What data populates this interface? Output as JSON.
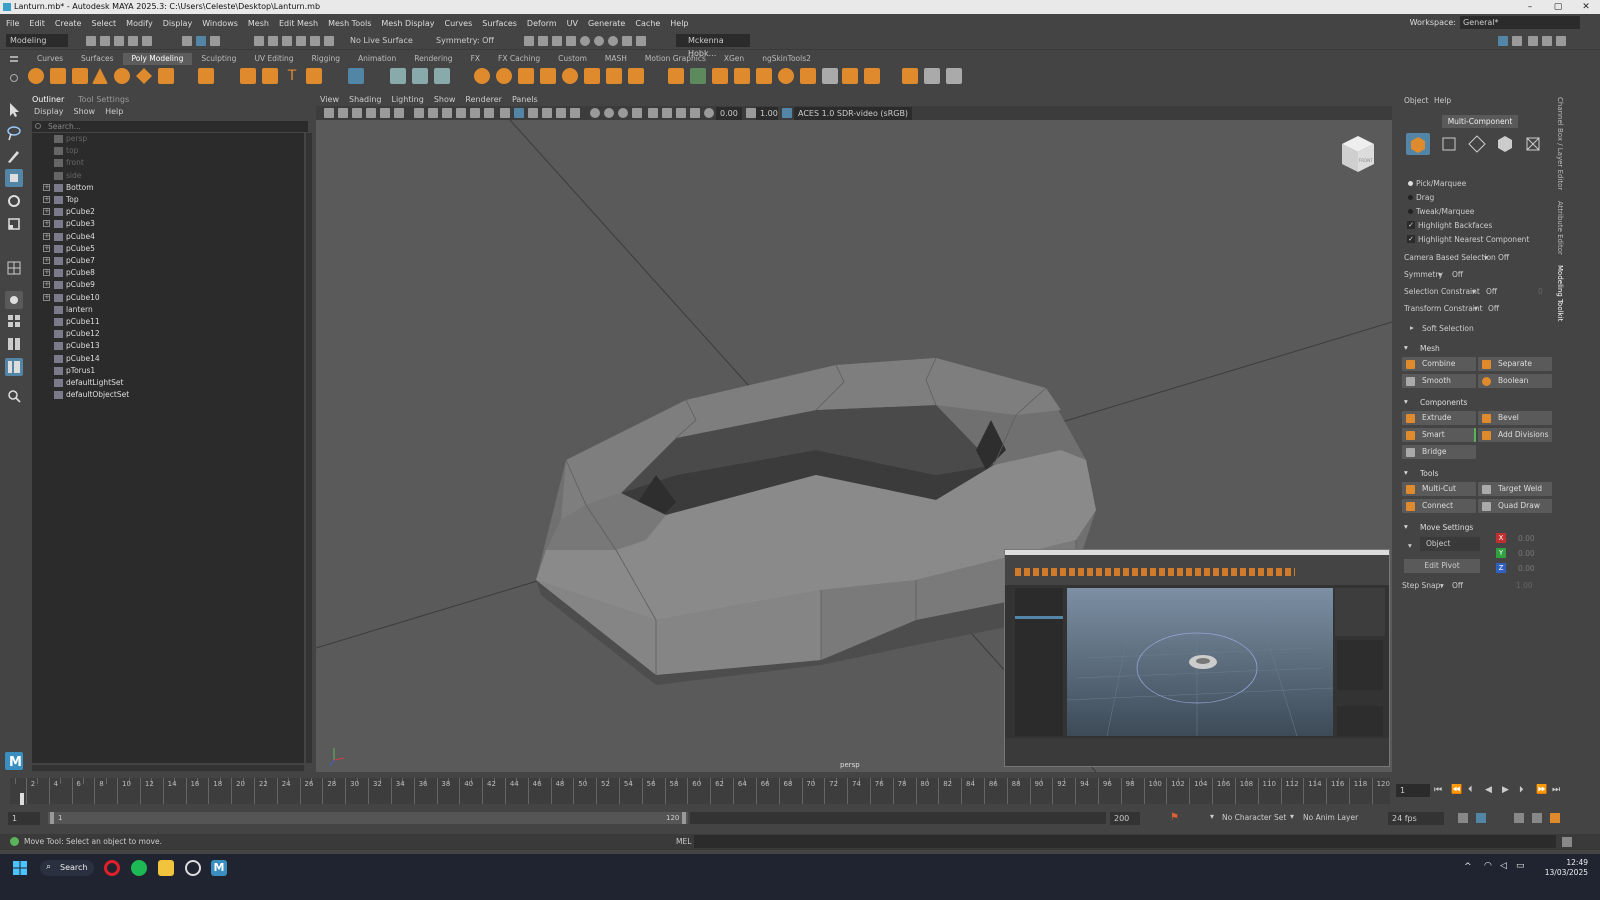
{
  "window": {
    "title": "Lanturn.mb* - Autodesk MAYA 2025.3: C:\\Users\\Celeste\\Desktop\\Lanturn.mb"
  },
  "menubar": {
    "items": [
      "File",
      "Edit",
      "Create",
      "Select",
      "Modify",
      "Display",
      "Windows",
      "Mesh",
      "Edit Mesh",
      "Mesh Tools",
      "Mesh Display",
      "Curves",
      "Surfaces",
      "Deform",
      "UV",
      "Generate",
      "Cache",
      "Help"
    ],
    "workspace_label": "Workspace:",
    "workspace_value": "General*"
  },
  "statusline": {
    "mode": "Modeling",
    "live_surface": "No Live Surface",
    "symmetry": "Symmetry: Off",
    "user": "Mckenna Hobk..."
  },
  "shelf": {
    "tabs": [
      "Curves",
      "Surfaces",
      "Poly Modeling",
      "Sculpting",
      "UV Editing",
      "Rigging",
      "Animation",
      "Rendering",
      "FX",
      "FX Caching",
      "Custom",
      "MASH",
      "Motion Graphics",
      "XGen",
      "ngSkinTools2"
    ],
    "active": "Poly Modeling"
  },
  "outliner": {
    "tabs": [
      "Outliner",
      "Tool Settings"
    ],
    "menu": [
      "Display",
      "Show",
      "Help"
    ],
    "search_placeholder": "Search...",
    "items": [
      {
        "label": "persp",
        "hidden": true,
        "expand": false
      },
      {
        "label": "top",
        "hidden": true,
        "expand": false
      },
      {
        "label": "front",
        "hidden": true,
        "expand": false
      },
      {
        "label": "side",
        "hidden": true,
        "expand": false
      },
      {
        "label": "Bottom",
        "hidden": false,
        "expand": true
      },
      {
        "label": "Top",
        "hidden": false,
        "expand": true
      },
      {
        "label": "pCube2",
        "hidden": false,
        "expand": true
      },
      {
        "label": "pCube3",
        "hidden": false,
        "expand": true
      },
      {
        "label": "pCube4",
        "hidden": false,
        "expand": true
      },
      {
        "label": "pCube5",
        "hidden": false,
        "expand": true
      },
      {
        "label": "pCube7",
        "hidden": false,
        "expand": true
      },
      {
        "label": "pCube8",
        "hidden": false,
        "expand": true
      },
      {
        "label": "pCube9",
        "hidden": false,
        "expand": true
      },
      {
        "label": "pCube10",
        "hidden": false,
        "expand": true
      },
      {
        "label": "lantern",
        "hidden": false,
        "expand": false
      },
      {
        "label": "pCube11",
        "hidden": false,
        "expand": false
      },
      {
        "label": "pCube12",
        "hidden": false,
        "expand": false
      },
      {
        "label": "pCube13",
        "hidden": false,
        "expand": false
      },
      {
        "label": "pCube14",
        "hidden": false,
        "expand": false
      },
      {
        "label": "pTorus1",
        "hidden": false,
        "expand": false
      },
      {
        "label": "defaultLightSet",
        "hidden": false,
        "expand": false
      },
      {
        "label": "defaultObjectSet",
        "hidden": false,
        "expand": false
      }
    ]
  },
  "viewport": {
    "menu": [
      "View",
      "Shading",
      "Lighting",
      "Show",
      "Renderer",
      "Panels"
    ],
    "field1": "0.00",
    "field2": "1.00",
    "colorspace": "ACES 1.0 SDR-video (sRGB)",
    "camera_label": "persp",
    "viewcube_label": "FRONT"
  },
  "modeling_toolkit": {
    "menu": [
      "Object",
      "Help"
    ],
    "mode_button": "Multi-Component",
    "pick_options": [
      "Pick/Marquee",
      "Drag",
      "Tweak/Marquee"
    ],
    "checks": [
      "Highlight Backfaces",
      "Highlight Nearest Component"
    ],
    "settings": [
      {
        "label": "Camera Based Selection",
        "value": "Off"
      },
      {
        "label": "Symmetry",
        "value": "Off"
      },
      {
        "label": "Selection Constraint",
        "value": "Off",
        "extra": "0"
      },
      {
        "label": "Transform Constraint",
        "value": "Off"
      }
    ],
    "soft_selection": "Soft Selection",
    "mesh": {
      "title": "Mesh",
      "buttons": [
        "Combine",
        "Separate",
        "Smooth",
        "Boolean"
      ]
    },
    "components": {
      "title": "Components",
      "buttons": [
        "Extrude",
        "Bevel",
        "Smart Extrude",
        "Add Divisions",
        "Bridge"
      ]
    },
    "tools": {
      "title": "Tools",
      "buttons": [
        "Multi-Cut",
        "Target Weld",
        "Connect",
        "Quad Draw"
      ]
    },
    "move_settings": {
      "title": "Move Settings",
      "space": "Object",
      "edit_pivot": "Edit Pivot",
      "step_snap_label": "Step Snap:",
      "step_snap_value": "Off",
      "step_value": "1.00",
      "x": "0.00",
      "y": "0.00",
      "z": "0.00",
      "axes": [
        "X",
        "Y",
        "Z"
      ]
    }
  },
  "side_tabs": [
    "Channel Box / Layer Editor",
    "Attribute Editor",
    "Modeling Toolkit"
  ],
  "timeline": {
    "ticks": [
      "2",
      "4",
      "6",
      "8",
      "10",
      "12",
      "14",
      "16",
      "18",
      "20",
      "22",
      "24",
      "26",
      "28",
      "30",
      "32",
      "34",
      "36",
      "38",
      "40",
      "42",
      "44",
      "46",
      "48",
      "50",
      "52",
      "54",
      "56",
      "58",
      "60",
      "62",
      "64",
      "66",
      "68",
      "70",
      "72",
      "74",
      "76",
      "78",
      "80",
      "82",
      "84",
      "86",
      "88",
      "90",
      "92",
      "94",
      "96",
      "98",
      "100",
      "102",
      "104",
      "106",
      "108",
      "110",
      "112",
      "114",
      "116",
      "118",
      "120"
    ],
    "current_frame": "1",
    "range_start": "1",
    "range_inner_start": "1",
    "range_inner_end": "120",
    "range_end": "200",
    "character_set": "No Character Set",
    "anim_layer": "No Anim Layer",
    "fps": "24 fps"
  },
  "command": {
    "help_text": "Move Tool: Select an object to move.",
    "lang": "MEL"
  },
  "taskbar": {
    "search": "Search",
    "time": "12:49",
    "date": "13/03/2025"
  },
  "colors": {
    "accent_orange": "#e08a2e",
    "selected_blue": "#5285a6"
  }
}
